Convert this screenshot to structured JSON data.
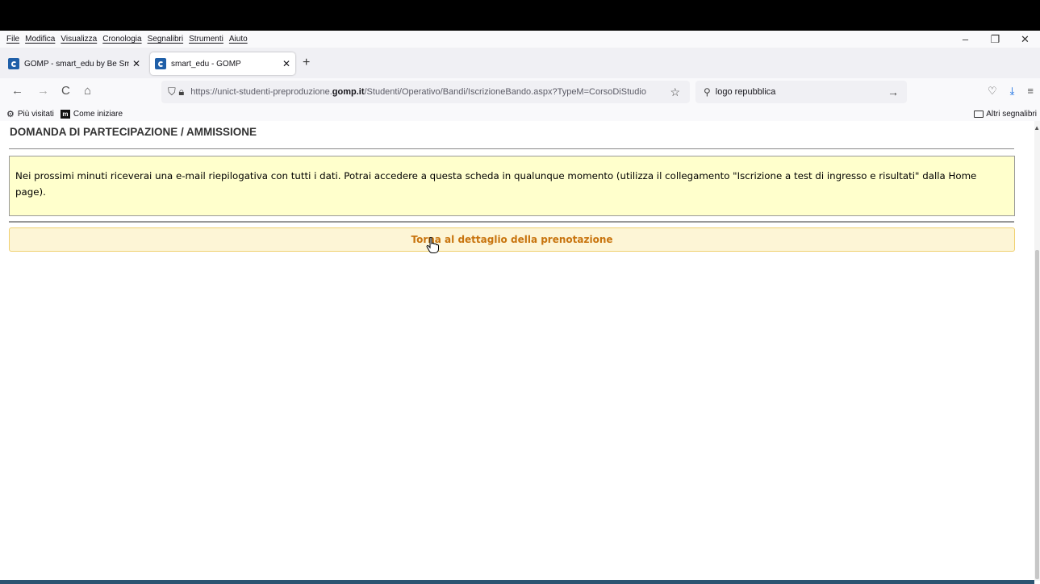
{
  "menu": [
    "File",
    "Modifica",
    "Visualizza",
    "Cronologia",
    "Segnalibri",
    "Strumenti",
    "Aiuto"
  ],
  "window_controls": {
    "minimize": "–",
    "restore": "❐",
    "close": "✕"
  },
  "tabs": [
    {
      "title": "GOMP - smart_edu by Be Smart",
      "close": "✕"
    },
    {
      "title": "smart_edu - GOMP",
      "close": "✕"
    }
  ],
  "new_tab": "+",
  "nav": {
    "back": "←",
    "forward": "→",
    "reload": "C",
    "home": "⌂"
  },
  "url": {
    "prefix": "https://unict-studenti-preproduzione.",
    "domain": "gomp.it",
    "path": "/Studenti/Operativo/Bandi/IscrizioneBando.aspx?TypeM=CorsoDiStudio"
  },
  "search": {
    "value": "logo repubblica",
    "go": "→"
  },
  "bookmarks": [
    {
      "label": "Più visitati",
      "icon": "gear-icon"
    },
    {
      "label": "Come iniziare",
      "icon": "m-logo-icon"
    }
  ],
  "other_bookmarks": "Altri segnalibri",
  "page": {
    "title": "DOMANDA DI PARTECIPAZIONE / AMMISSIONE",
    "notice": "Nei prossimi minuti riceverai una e-mail riepilogativa con tutti i dati. Potrai accedere a questa scheda in qualunque momento (utilizza il collegamento \"Iscrizione a test di ingresso e risultati\" dalla Home page).",
    "return_button": "Torna al dettaglio della prenotazione"
  },
  "colors": {
    "notice_bg": "#ffffcc",
    "button_bg": "#fdf5d6",
    "button_text": "#c8740e",
    "download_accent": "#0060df"
  }
}
